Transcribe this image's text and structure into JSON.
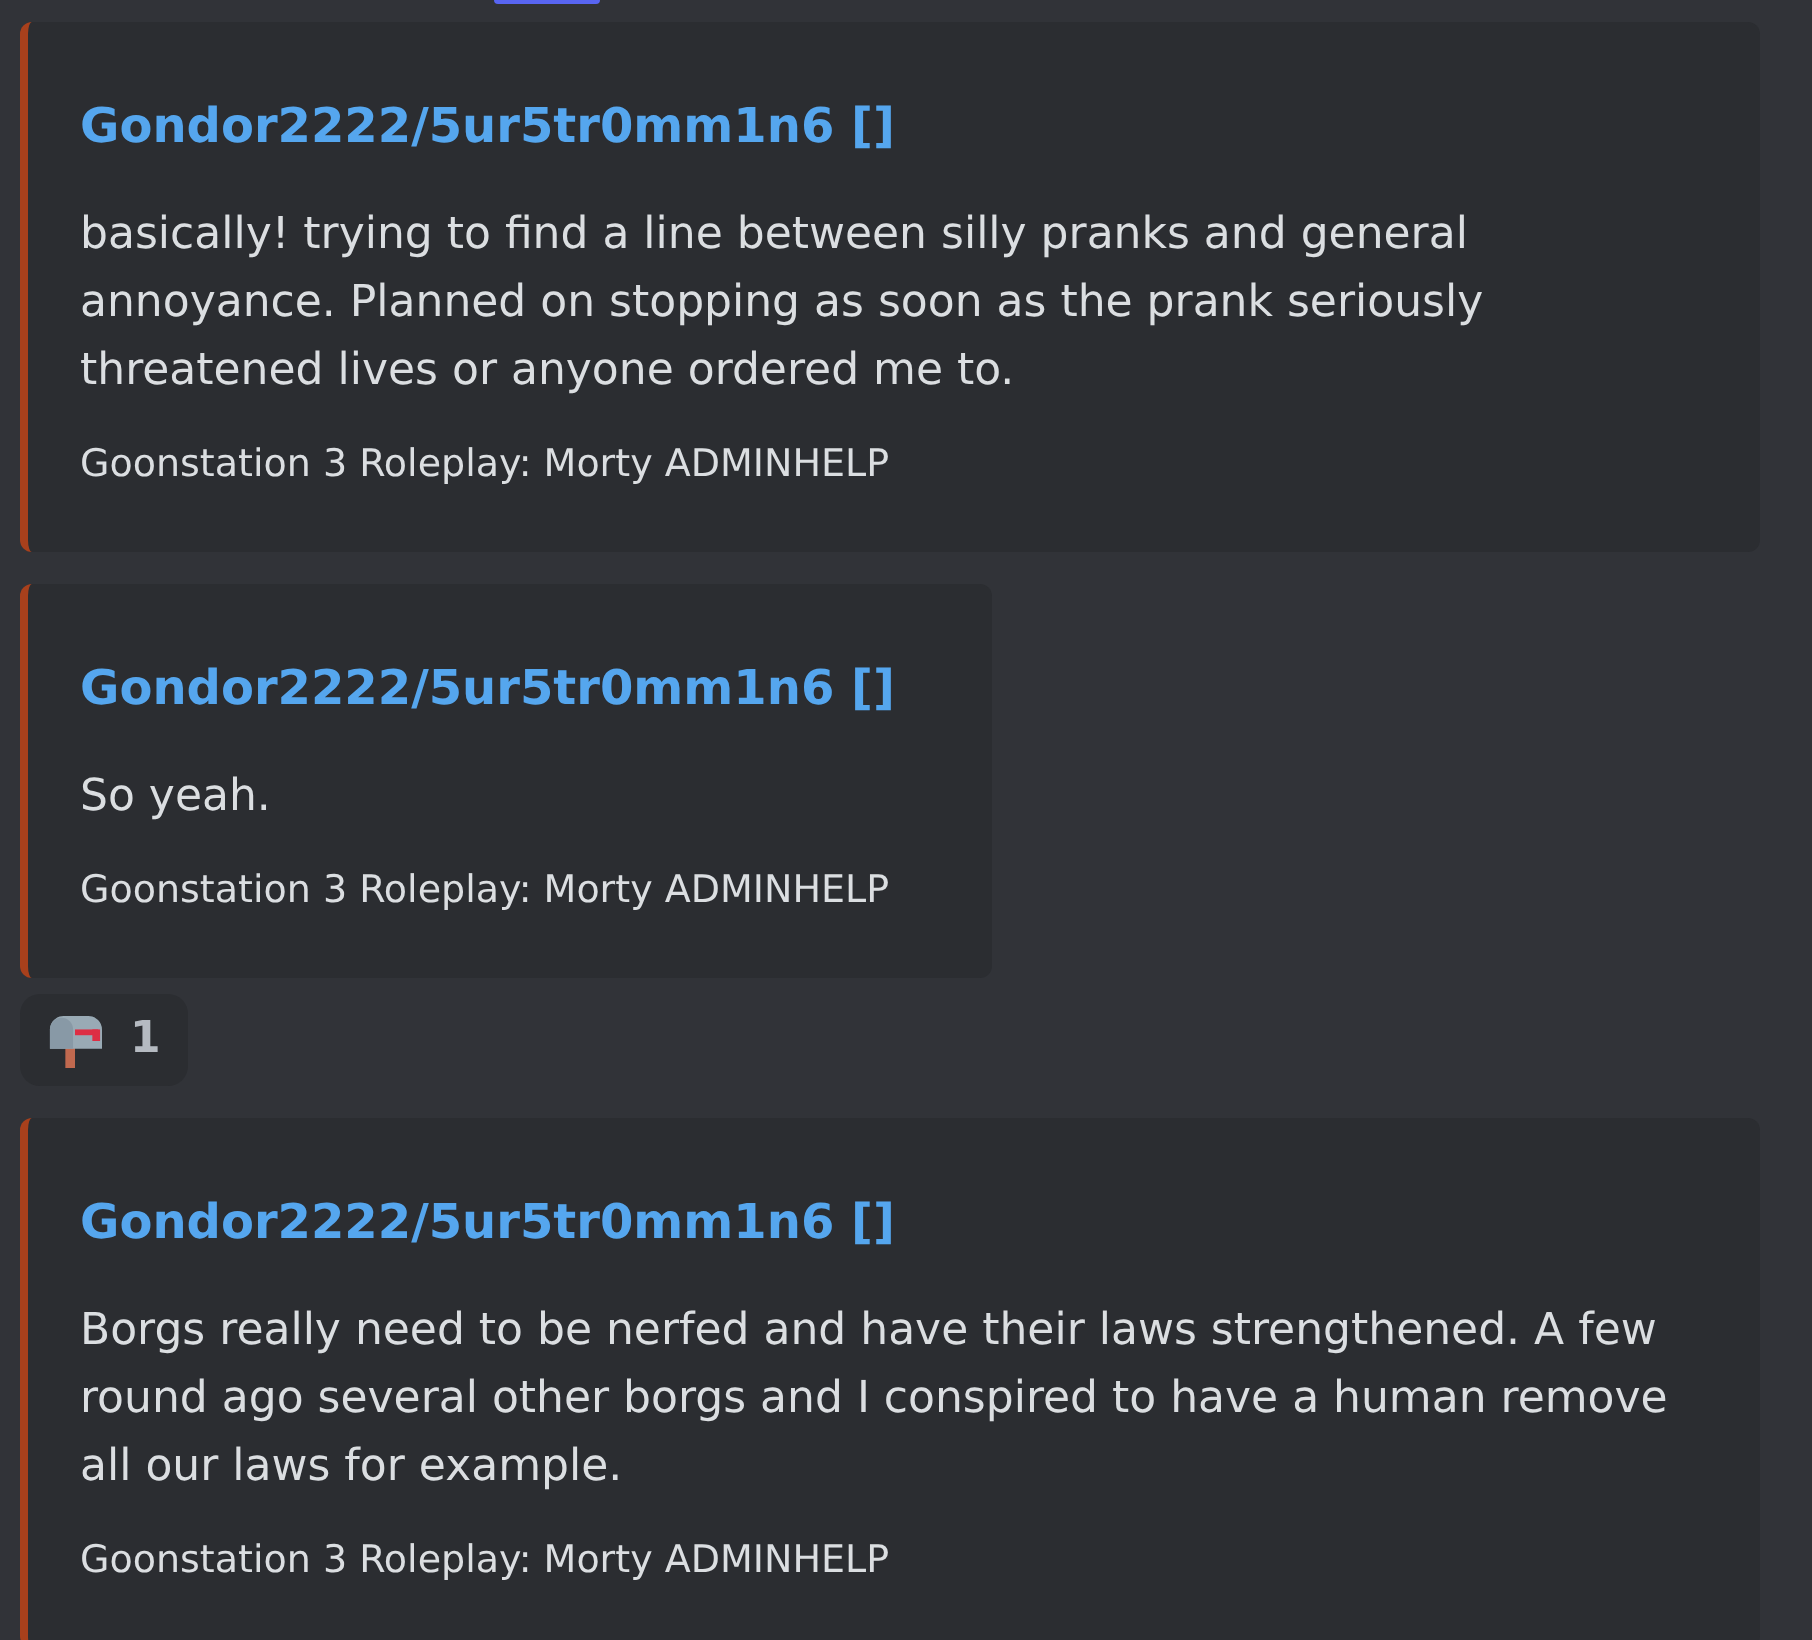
{
  "embeds": [
    {
      "title": "Gondor2222/5ur5tr0mm1n6 []",
      "description": "basically! trying to find a line between silly pranks and general annoyance. Planned on stopping as soon as the prank seriously threatened lives or anyone ordered me to.",
      "footer": "Goonstation 3 Roleplay: Morty ADMINHELP"
    },
    {
      "title": "Gondor2222/5ur5tr0mm1n6 []",
      "description": "So yeah.",
      "footer": "Goonstation 3 Roleplay: Morty ADMINHELP",
      "reactions": [
        {
          "count": "1"
        }
      ]
    },
    {
      "title": "Gondor2222/5ur5tr0mm1n6 []",
      "description": "Borgs really need to be nerfed and have their laws strengthened. A few round ago several other borgs and I conspired to have a human remove all our laws for example.",
      "footer": "Goonstation 3 Roleplay: Morty ADMINHELP"
    }
  ]
}
